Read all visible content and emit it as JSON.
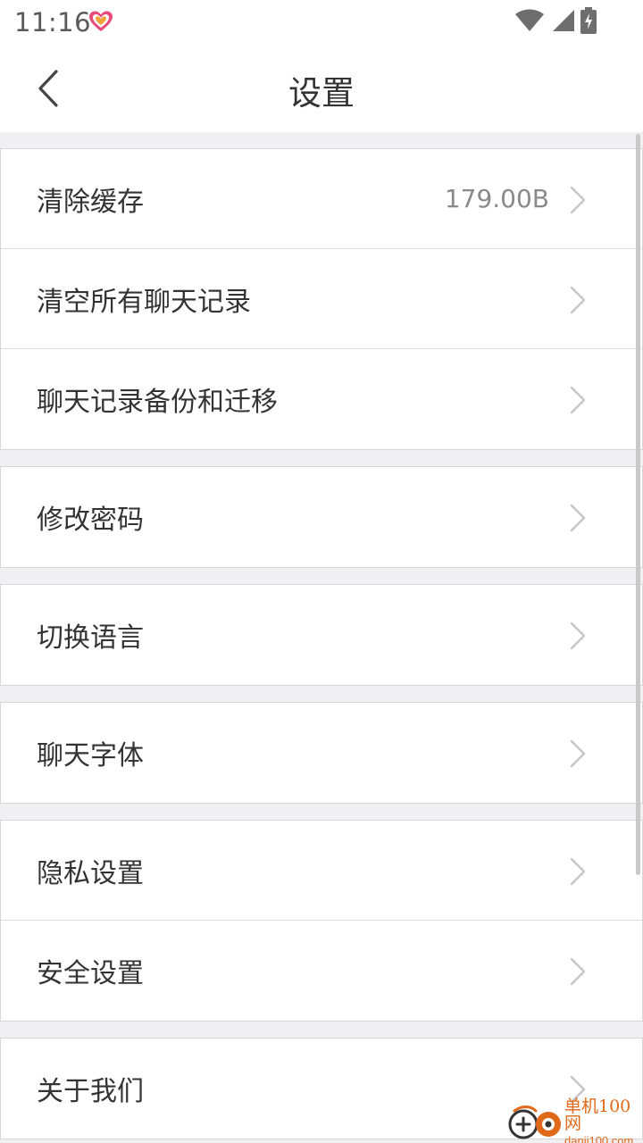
{
  "status_bar": {
    "time": "11:16",
    "icons": [
      "app-heart-icon",
      "wifi-icon",
      "cell-signal-icon",
      "battery-charging-icon"
    ]
  },
  "title_bar": {
    "title": "设置",
    "back_icon": "chevron-left-icon"
  },
  "groups": [
    {
      "items": [
        {
          "label": "清除缓存",
          "value": "179.00B"
        },
        {
          "label": "清空所有聊天记录",
          "value": ""
        },
        {
          "label": "聊天记录备份和迁移",
          "value": ""
        }
      ]
    },
    {
      "items": [
        {
          "label": "修改密码",
          "value": ""
        }
      ]
    },
    {
      "items": [
        {
          "label": "切换语言",
          "value": ""
        }
      ]
    },
    {
      "items": [
        {
          "label": "聊天字体",
          "value": ""
        }
      ]
    },
    {
      "items": [
        {
          "label": "隐私设置",
          "value": ""
        },
        {
          "label": "安全设置",
          "value": ""
        }
      ]
    },
    {
      "items": [
        {
          "label": "关于我们",
          "value": ""
        }
      ]
    }
  ],
  "watermark": {
    "name": "单机100网",
    "url": "danji100.com"
  },
  "colors": {
    "background": "#f0eff4",
    "row_bg": "#ffffff",
    "text": "#333333",
    "secondary_text": "#8a8a8a",
    "chevron": "#c4c4c4",
    "watermark": "#e06a1a"
  }
}
